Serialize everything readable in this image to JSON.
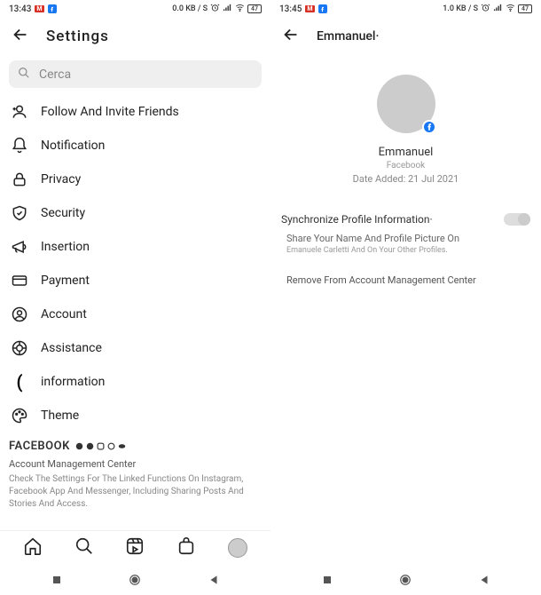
{
  "left": {
    "status": {
      "time": "13:43",
      "data": "0.0 KB / S",
      "batt": "47"
    },
    "title": "Settings",
    "search_placeholder": "Cerca",
    "menu": [
      {
        "label": "Follow And Invite Friends"
      },
      {
        "label": "Notification"
      },
      {
        "label": "Privacy"
      },
      {
        "label": "Security"
      },
      {
        "label": "Insertion"
      },
      {
        "label": "Payment"
      },
      {
        "label": "Account"
      },
      {
        "label": "Assistance"
      },
      {
        "label": "information"
      },
      {
        "label": "Theme"
      }
    ],
    "fb": {
      "title": "FACEBOOK",
      "sub": "Account Management Center",
      "desc": "Check The Settings For The Linked Functions On Instagram, Facebook App And Messenger, Including Sharing Posts And Stories And Access."
    }
  },
  "right": {
    "status": {
      "time": "13:45",
      "data": "1.0 KB / S",
      "batt": "47"
    },
    "title": "Emmanuel·",
    "profile": {
      "name": "Emmanuel",
      "sub": "Facebook",
      "date": "Date Added: 21 Jul 2021"
    },
    "sync_label": "Synchronize Profile Information·",
    "share": {
      "title": "Share Your Name And Profile Picture On",
      "sub": "Emanuele Carletti And On Your Other Profiles."
    },
    "remove_label": "Remove From Account Management Center"
  }
}
